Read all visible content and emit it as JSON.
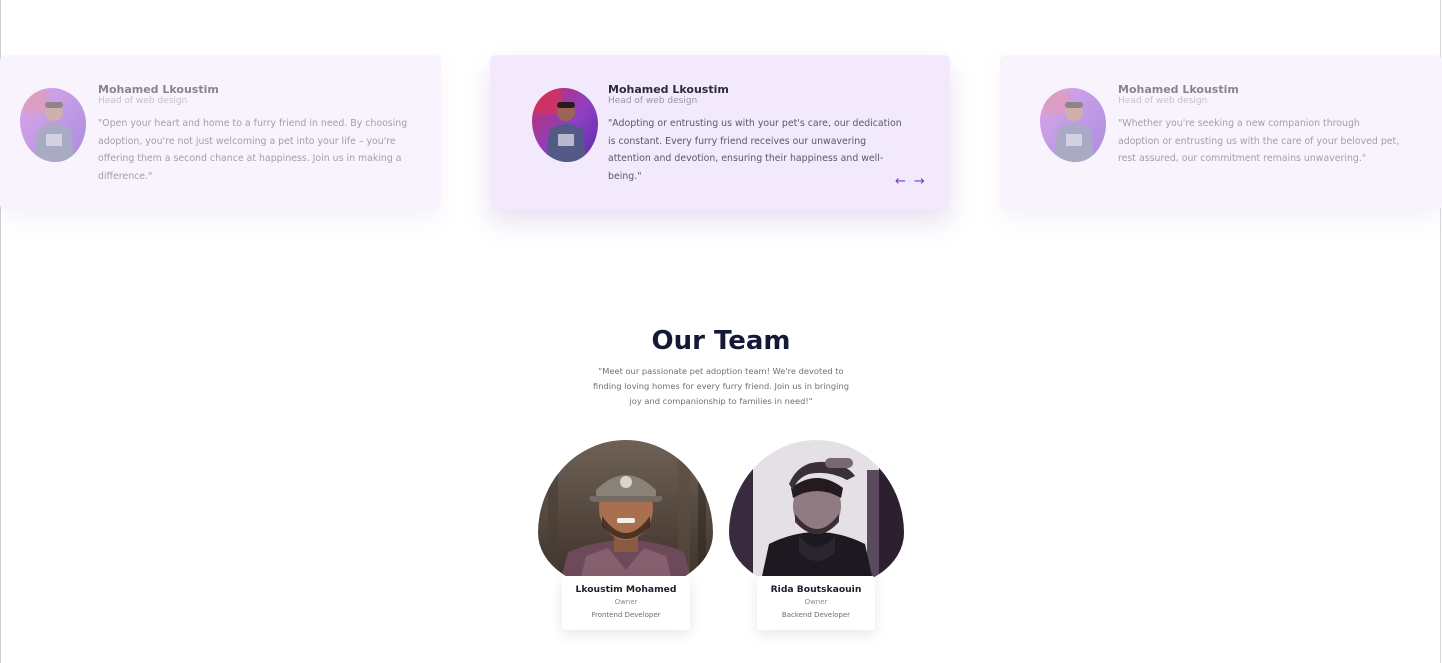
{
  "testimonials": [
    {
      "name": "Mohamed Lkoustim",
      "role": "Head of web design",
      "quote": "\"Open your heart and home to a furry friend in need. By choosing adoption, you're not just welcoming a pet into your life – you're offering them a second chance at happiness. Join us in making a difference.\""
    },
    {
      "name": "Mohamed Lkoustim",
      "role": "Head of web design",
      "quote": "\"Adopting or entrusting us with your pet's care, our dedication is constant. Every furry friend receives our unwavering attention and devotion, ensuring their happiness and well-being.\""
    },
    {
      "name": "Mohamed Lkoustim",
      "role": "Head of web design",
      "quote": "\"Whether you're seeking a new companion through adoption or entrusting us with the care of your beloved pet, rest assured, our commitment remains unwavering.\""
    }
  ],
  "carousel": {
    "prev_label": "←",
    "next_label": "→"
  },
  "team": {
    "title": "Our Team",
    "subtitle": "\"Meet our passionate pet adoption team! We're devoted to finding loving homes for every furry friend. Join us in bringing joy and companionship to families in need!\"",
    "members": [
      {
        "name": "Lkoustim Mohamed",
        "role": "Owner",
        "title": "Frontend Developer"
      },
      {
        "name": "Rida Boutskaouin",
        "role": "Owner",
        "title": "Backend Developer"
      }
    ]
  },
  "colors": {
    "accent": "#7a3bb5",
    "card_center": "#f3e9fd",
    "card_side": "#f8f3fd",
    "heading": "#141a36"
  }
}
